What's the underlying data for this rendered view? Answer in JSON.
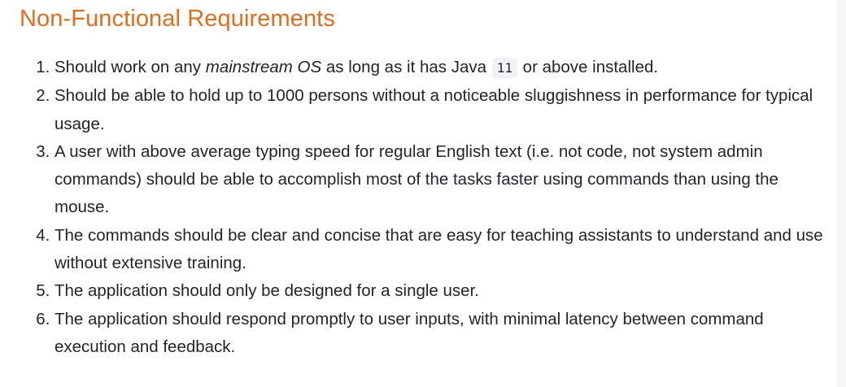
{
  "section": {
    "title": "Non-Functional Requirements"
  },
  "requirements": [
    {
      "parts": {
        "before": "Should work on any ",
        "emphasis": "mainstream OS",
        "middle": " as long as it has Java ",
        "code": "11",
        "after": " or above installed."
      }
    },
    {
      "text": "Should be able to hold up to 1000 persons without a noticeable sluggishness in performance for typical usage."
    },
    {
      "text": "A user with above average typing speed for regular English text (i.e. not code, not system admin commands) should be able to accomplish most of the tasks faster using commands than using the mouse."
    },
    {
      "text": "The commands should be clear and concise that are easy for teaching assistants to understand and use without extensive training."
    },
    {
      "text": "The application should only be designed for a single user."
    },
    {
      "text": "The application should respond promptly to user inputs, with minimal latency between command execution and feedback."
    }
  ],
  "colors": {
    "heading": "#e46c1c",
    "body_text": "#212529",
    "code_background": "#f1f2f6"
  }
}
